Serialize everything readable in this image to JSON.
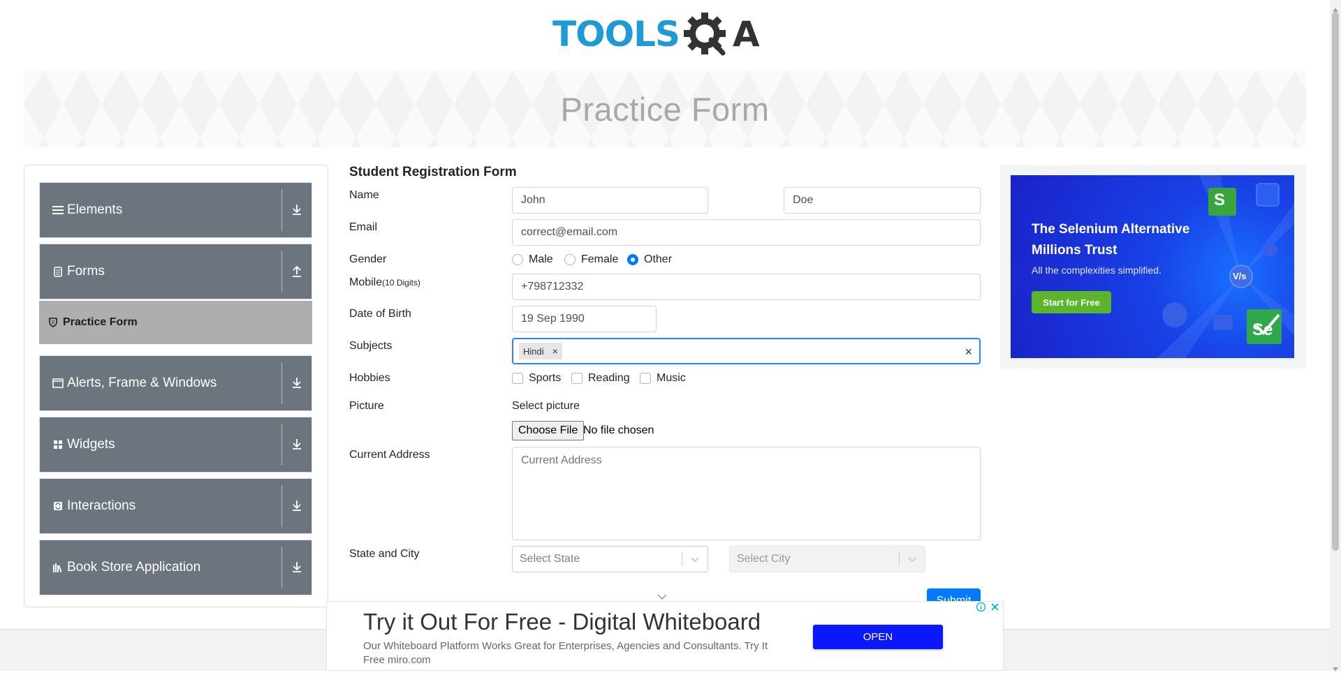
{
  "header": {
    "logo_text_left": "TOOLS",
    "logo_text_right": "A",
    "banner_title": "Practice Form"
  },
  "colors": {
    "logo_blue": "#1e9ad6",
    "logo_dark": "#333333",
    "sidebar_group": "#6c757d",
    "submenu_active": "#aeaeae",
    "primary": "#007bff",
    "ad_green": "#5bb52a",
    "open_button": "#0a17ff"
  },
  "sidebar": {
    "groups": [
      {
        "label": "Elements",
        "icon": "hamburger-icon",
        "arrow": "download-arrow-icon"
      },
      {
        "label": "Forms",
        "icon": "document-icon",
        "arrow": "upload-arrow-icon"
      },
      {
        "label": "Alerts, Frame & Windows",
        "icon": "window-icon",
        "arrow": "download-arrow-icon"
      },
      {
        "label": "Widgets",
        "icon": "grid-icon",
        "arrow": "download-arrow-icon"
      },
      {
        "label": "Interactions",
        "icon": "sync-icon",
        "arrow": "download-arrow-icon"
      },
      {
        "label": "Book Store Application",
        "icon": "books-icon",
        "arrow": "download-arrow-icon"
      }
    ],
    "active_item": {
      "label": "Practice Form",
      "icon": "shield-icon"
    }
  },
  "form": {
    "title": "Student Registration Form",
    "name_label": "Name",
    "first_name": "John",
    "last_name": "Doe",
    "email_label": "Email",
    "email": "correct@email.com",
    "gender_label": "Gender",
    "genders": [
      "Male",
      "Female",
      "Other"
    ],
    "gender_selected": "Other",
    "mobile_label": "Mobile",
    "mobile_hint": "(10 Digits)",
    "mobile": "+798712332",
    "dob_label": "Date of Birth",
    "dob": "19 Sep 1990",
    "subjects_label": "Subjects",
    "subjects": [
      "Hindi"
    ],
    "subject_remove": "×",
    "subjects_clear": "×",
    "hobbies_label": "Hobbies",
    "hobbies": [
      "Sports",
      "Reading",
      "Music"
    ],
    "picture_label": "Picture",
    "picture_hint": "Select picture",
    "file_button": "Choose File",
    "file_status": "No file chosen",
    "address_label": "Current Address",
    "address_placeholder": "Current Address",
    "state_city_label": "State and City",
    "state_placeholder": "Select State",
    "city_placeholder": "Select City",
    "submit_label": "Submit"
  },
  "ad_right": {
    "headline": "The Selenium Alternative Millions Trust",
    "subtext": "All the complexities simplified.",
    "cta": "Start for Free",
    "badge_s": "S",
    "badge_vs": "V/s",
    "badge_se": "Se"
  },
  "ad_bottom": {
    "title": "Try it Out For Free - Digital Whiteboard",
    "description": "Our Whiteboard Platform Works Great for Enterprises, Agencies and Consultants. Try It Free miro.com",
    "button": "OPEN"
  }
}
